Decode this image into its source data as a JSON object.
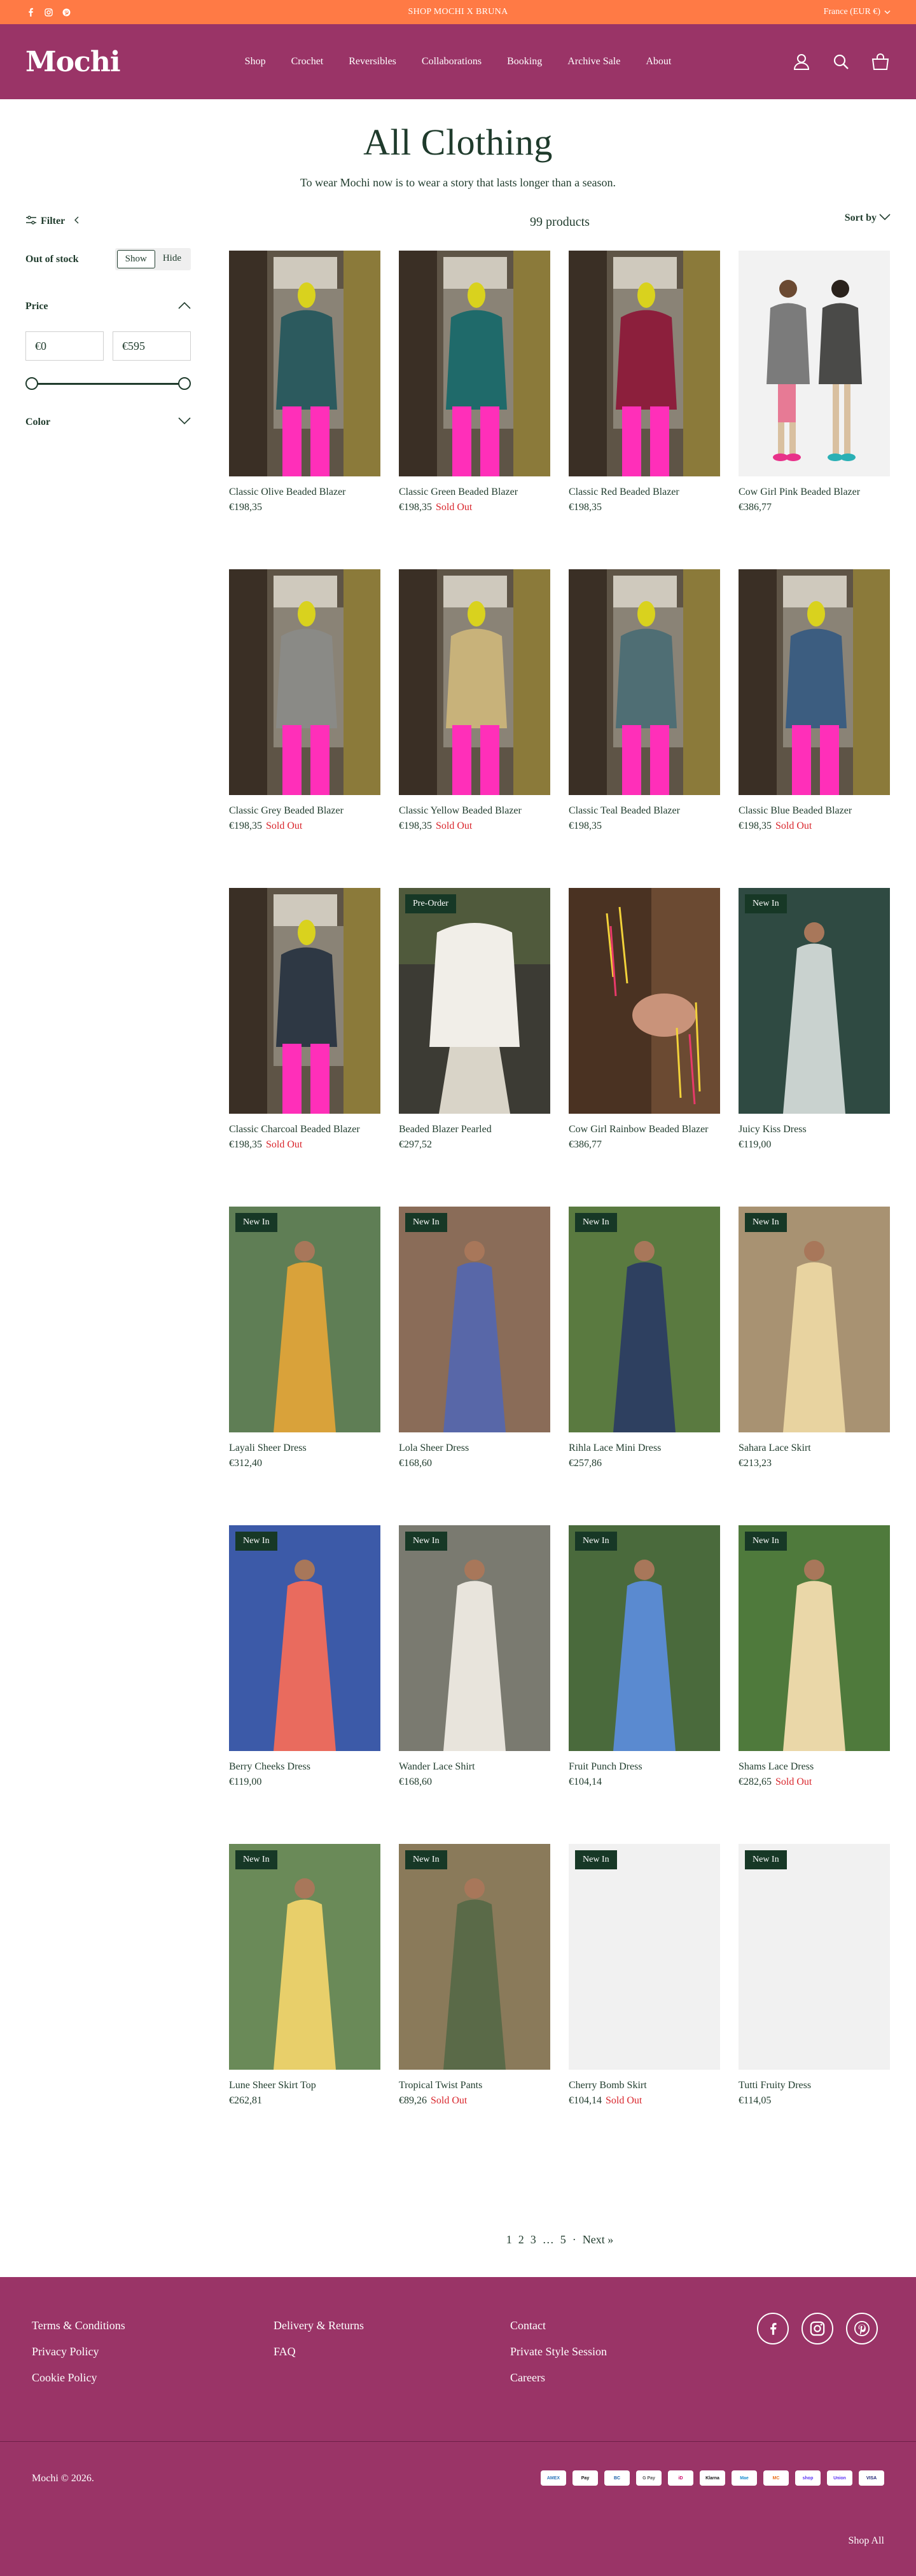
{
  "announcement": {
    "text": "SHOP MOCHI X BRUNA",
    "currency": "France (EUR €)"
  },
  "brand": {
    "logo": "Mochi"
  },
  "nav": [
    "Shop",
    "Crochet",
    "Reversibles",
    "Collaborations",
    "Booking",
    "Archive Sale",
    "About"
  ],
  "page": {
    "title": "All Clothing",
    "tagline": "To wear Mochi now is to wear a story that lasts longer than a season."
  },
  "filters": {
    "label": "Filter",
    "out_of_stock": {
      "label": "Out of stock",
      "options": [
        "Show",
        "Hide"
      ],
      "selected": "Show"
    },
    "price": {
      "label": "Price",
      "min": "€0",
      "max": "€595"
    },
    "color": {
      "label": "Color"
    }
  },
  "toolbar": {
    "count": "99 products",
    "sort_label": "Sort by"
  },
  "sold_out_label": "Sold Out",
  "products": [
    {
      "name": "Classic Olive Beaded Blazer",
      "price": "€198,35",
      "sold_out": false,
      "badge": "",
      "img": "blazer",
      "jacket": "#2c5a5e",
      "bg": "#6b6152"
    },
    {
      "name": "Classic Green Beaded Blazer",
      "price": "€198,35",
      "sold_out": true,
      "badge": "",
      "img": "blazer",
      "jacket": "#1f6a6a",
      "bg": "#6b6152"
    },
    {
      "name": "Classic Red Beaded Blazer",
      "price": "€198,35",
      "sold_out": false,
      "badge": "",
      "img": "blazer",
      "jacket": "#8c1f3c",
      "bg": "#6b6152"
    },
    {
      "name": "Cow Girl Pink Beaded Blazer",
      "price": "€386,77",
      "sold_out": false,
      "badge": "",
      "img": "cowgirl",
      "jacket": "#7b7b7b",
      "bg": "#f2f2f2"
    },
    {
      "name": "Classic Grey Beaded Blazer",
      "price": "€198,35",
      "sold_out": true,
      "badge": "",
      "img": "blazer",
      "jacket": "#8a8a86",
      "bg": "#6b6152"
    },
    {
      "name": "Classic Yellow Beaded Blazer",
      "price": "€198,35",
      "sold_out": true,
      "badge": "",
      "img": "blazer",
      "jacket": "#c8b27a",
      "bg": "#6b6152"
    },
    {
      "name": "Classic Teal Beaded Blazer",
      "price": "€198,35",
      "sold_out": false,
      "badge": "",
      "img": "blazer",
      "jacket": "#4f6e74",
      "bg": "#6b6152"
    },
    {
      "name": "Classic Blue Beaded Blazer",
      "price": "€198,35",
      "sold_out": true,
      "badge": "",
      "img": "blazer",
      "jacket": "#3c5d80",
      "bg": "#6b6152"
    },
    {
      "name": "Classic Charcoal Beaded Blazer",
      "price": "€198,35",
      "sold_out": true,
      "badge": "",
      "img": "blazer",
      "jacket": "#2e3844",
      "bg": "#6b6152"
    },
    {
      "name": "Beaded Blazer Pearled",
      "price": "€297,52",
      "sold_out": false,
      "badge": "Pre-Order",
      "img": "pearl",
      "jacket": "#f1eee8",
      "bg": "#3c3b34"
    },
    {
      "name": "Cow Girl Rainbow Beaded Blazer",
      "price": "€386,77",
      "sold_out": false,
      "badge": "",
      "img": "brown",
      "jacket": "#5a3b28",
      "bg": "#4a3222"
    },
    {
      "name": "Juicy Kiss Dress",
      "price": "€119,00",
      "sold_out": false,
      "badge": "New In",
      "img": "dress",
      "jacket": "#c9d2cf",
      "bg": "#2f4a42"
    },
    {
      "name": "Layali Sheer Dress",
      "price": "€312,40",
      "sold_out": false,
      "badge": "New In",
      "img": "dress",
      "jacket": "#d9a23a",
      "bg": "#5f7e55"
    },
    {
      "name": "Lola Sheer Dress",
      "price": "€168,60",
      "sold_out": false,
      "badge": "New In",
      "img": "dress",
      "jacket": "#5867a8",
      "bg": "#8a6c58"
    },
    {
      "name": "Rihla Lace Mini Dress",
      "price": "€257,86",
      "sold_out": false,
      "badge": "New In",
      "img": "dress",
      "jacket": "#2e4060",
      "bg": "#5a7a40"
    },
    {
      "name": "Sahara Lace Skirt",
      "price": "€213,23",
      "sold_out": false,
      "badge": "New In",
      "img": "dress",
      "jacket": "#e8d3a0",
      "bg": "#a89272"
    },
    {
      "name": "Berry Cheeks Dress",
      "price": "€119,00",
      "sold_out": false,
      "badge": "New In",
      "img": "dress",
      "jacket": "#e96b5e",
      "bg": "#3c5aa8"
    },
    {
      "name": "Wander Lace Shirt",
      "price": "€168,60",
      "sold_out": false,
      "badge": "New In",
      "img": "dress",
      "jacket": "#e8e4dc",
      "bg": "#7a7a70"
    },
    {
      "name": "Fruit Punch Dress",
      "price": "€104,14",
      "sold_out": false,
      "badge": "New In",
      "img": "dress",
      "jacket": "#5a8ad0",
      "bg": "#4a6a3c"
    },
    {
      "name": "Shams Lace Dress",
      "price": "€282,65",
      "sold_out": true,
      "badge": "New In",
      "img": "dress",
      "jacket": "#ead7a8",
      "bg": "#4f7a3c"
    },
    {
      "name": "Lune Sheer Skirt Top",
      "price": "€262,81",
      "sold_out": false,
      "badge": "New In",
      "img": "dress",
      "jacket": "#e8cf6a",
      "bg": "#6a8a58"
    },
    {
      "name": "Tropical Twist Pants",
      "price": "€89,26",
      "sold_out": true,
      "badge": "New In",
      "img": "dress",
      "jacket": "#5a6a48",
      "bg": "#8a7a5a"
    },
    {
      "name": "Cherry Bomb Skirt",
      "price": "€104,14",
      "sold_out": true,
      "badge": "New In",
      "img": "empty",
      "jacket": "",
      "bg": "#f1f1f1"
    },
    {
      "name": "Tutti Fruity Dress",
      "price": "€114,05",
      "sold_out": false,
      "badge": "New In",
      "img": "empty",
      "jacket": "",
      "bg": "#f1f1f1"
    }
  ],
  "pagination": {
    "pages": [
      "1",
      "2",
      "3",
      "…",
      "5",
      "·"
    ],
    "next": "Next »"
  },
  "footer": {
    "col1": [
      "Terms & Conditions",
      "Privacy Policy",
      "Cookie Policy"
    ],
    "col2": [
      "Delivery & Returns",
      "FAQ"
    ],
    "col3": [
      "Contact",
      "Private Style Session",
      "Careers"
    ],
    "copyright": "Mochi © 2026.",
    "payments": [
      {
        "name": "AMEX",
        "color": "#2e77bb"
      },
      {
        "name": "Pay",
        "color": "#111111"
      },
      {
        "name": "BC",
        "color": "#1b5fa8"
      },
      {
        "name": "G Pay",
        "color": "#555555"
      },
      {
        "name": "iD",
        "color": "#cc0066"
      },
      {
        "name": "Klarna",
        "color": "#111111"
      },
      {
        "name": "Mae",
        "color": "#1b8fd0"
      },
      {
        "name": "MC",
        "color": "#eb6f1c"
      },
      {
        "name": "shop",
        "color": "#ffffff"
      },
      {
        "name": "Union",
        "color": "#ffffff"
      },
      {
        "name": "VISA",
        "color": "#1a1f71"
      }
    ],
    "shop_all": "Shop All"
  }
}
